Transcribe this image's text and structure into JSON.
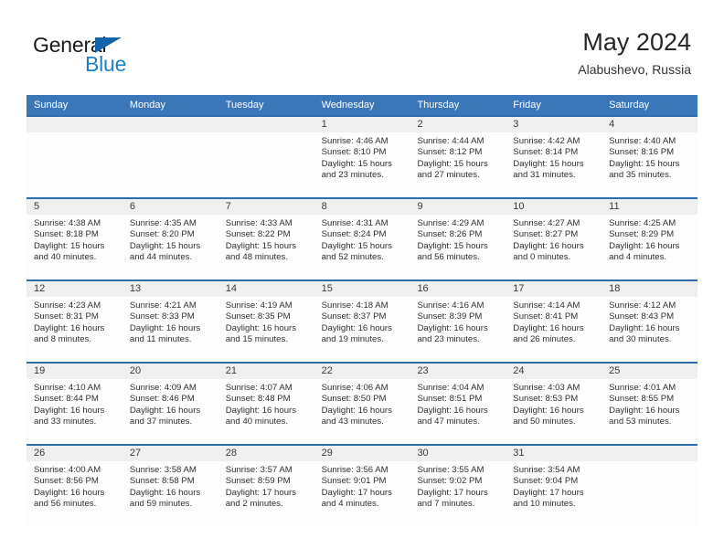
{
  "brand": {
    "line1": "General",
    "line2": "Blue",
    "triangle_icon": "triangle-icon",
    "color_dark": "#1b1b1b",
    "color_blue": "#1f7fc4"
  },
  "header": {
    "title": "May 2024",
    "subtitle": "Alabushevo, Russia"
  },
  "colors": {
    "header_blue": "#3a76b8",
    "row_divider_blue": "#2e6da9",
    "date_band_gray": "#efefef",
    "body_white": "#fdfdfd"
  },
  "weekdays": [
    "Sunday",
    "Monday",
    "Tuesday",
    "Wednesday",
    "Thursday",
    "Friday",
    "Saturday"
  ],
  "weeks": [
    [
      {
        "day": "",
        "l1": "",
        "l2": "",
        "l3": "",
        "l4": ""
      },
      {
        "day": "",
        "l1": "",
        "l2": "",
        "l3": "",
        "l4": ""
      },
      {
        "day": "",
        "l1": "",
        "l2": "",
        "l3": "",
        "l4": ""
      },
      {
        "day": "1",
        "l1": "Sunrise: 4:46 AM",
        "l2": "Sunset: 8:10 PM",
        "l3": "Daylight: 15 hours",
        "l4": "and 23 minutes."
      },
      {
        "day": "2",
        "l1": "Sunrise: 4:44 AM",
        "l2": "Sunset: 8:12 PM",
        "l3": "Daylight: 15 hours",
        "l4": "and 27 minutes."
      },
      {
        "day": "3",
        "l1": "Sunrise: 4:42 AM",
        "l2": "Sunset: 8:14 PM",
        "l3": "Daylight: 15 hours",
        "l4": "and 31 minutes."
      },
      {
        "day": "4",
        "l1": "Sunrise: 4:40 AM",
        "l2": "Sunset: 8:16 PM",
        "l3": "Daylight: 15 hours",
        "l4": "and 35 minutes."
      }
    ],
    [
      {
        "day": "5",
        "l1": "Sunrise: 4:38 AM",
        "l2": "Sunset: 8:18 PM",
        "l3": "Daylight: 15 hours",
        "l4": "and 40 minutes."
      },
      {
        "day": "6",
        "l1": "Sunrise: 4:35 AM",
        "l2": "Sunset: 8:20 PM",
        "l3": "Daylight: 15 hours",
        "l4": "and 44 minutes."
      },
      {
        "day": "7",
        "l1": "Sunrise: 4:33 AM",
        "l2": "Sunset: 8:22 PM",
        "l3": "Daylight: 15 hours",
        "l4": "and 48 minutes."
      },
      {
        "day": "8",
        "l1": "Sunrise: 4:31 AM",
        "l2": "Sunset: 8:24 PM",
        "l3": "Daylight: 15 hours",
        "l4": "and 52 minutes."
      },
      {
        "day": "9",
        "l1": "Sunrise: 4:29 AM",
        "l2": "Sunset: 8:26 PM",
        "l3": "Daylight: 15 hours",
        "l4": "and 56 minutes."
      },
      {
        "day": "10",
        "l1": "Sunrise: 4:27 AM",
        "l2": "Sunset: 8:27 PM",
        "l3": "Daylight: 16 hours",
        "l4": "and 0 minutes."
      },
      {
        "day": "11",
        "l1": "Sunrise: 4:25 AM",
        "l2": "Sunset: 8:29 PM",
        "l3": "Daylight: 16 hours",
        "l4": "and 4 minutes."
      }
    ],
    [
      {
        "day": "12",
        "l1": "Sunrise: 4:23 AM",
        "l2": "Sunset: 8:31 PM",
        "l3": "Daylight: 16 hours",
        "l4": "and 8 minutes."
      },
      {
        "day": "13",
        "l1": "Sunrise: 4:21 AM",
        "l2": "Sunset: 8:33 PM",
        "l3": "Daylight: 16 hours",
        "l4": "and 11 minutes."
      },
      {
        "day": "14",
        "l1": "Sunrise: 4:19 AM",
        "l2": "Sunset: 8:35 PM",
        "l3": "Daylight: 16 hours",
        "l4": "and 15 minutes."
      },
      {
        "day": "15",
        "l1": "Sunrise: 4:18 AM",
        "l2": "Sunset: 8:37 PM",
        "l3": "Daylight: 16 hours",
        "l4": "and 19 minutes."
      },
      {
        "day": "16",
        "l1": "Sunrise: 4:16 AM",
        "l2": "Sunset: 8:39 PM",
        "l3": "Daylight: 16 hours",
        "l4": "and 23 minutes."
      },
      {
        "day": "17",
        "l1": "Sunrise: 4:14 AM",
        "l2": "Sunset: 8:41 PM",
        "l3": "Daylight: 16 hours",
        "l4": "and 26 minutes."
      },
      {
        "day": "18",
        "l1": "Sunrise: 4:12 AM",
        "l2": "Sunset: 8:43 PM",
        "l3": "Daylight: 16 hours",
        "l4": "and 30 minutes."
      }
    ],
    [
      {
        "day": "19",
        "l1": "Sunrise: 4:10 AM",
        "l2": "Sunset: 8:44 PM",
        "l3": "Daylight: 16 hours",
        "l4": "and 33 minutes."
      },
      {
        "day": "20",
        "l1": "Sunrise: 4:09 AM",
        "l2": "Sunset: 8:46 PM",
        "l3": "Daylight: 16 hours",
        "l4": "and 37 minutes."
      },
      {
        "day": "21",
        "l1": "Sunrise: 4:07 AM",
        "l2": "Sunset: 8:48 PM",
        "l3": "Daylight: 16 hours",
        "l4": "and 40 minutes."
      },
      {
        "day": "22",
        "l1": "Sunrise: 4:06 AM",
        "l2": "Sunset: 8:50 PM",
        "l3": "Daylight: 16 hours",
        "l4": "and 43 minutes."
      },
      {
        "day": "23",
        "l1": "Sunrise: 4:04 AM",
        "l2": "Sunset: 8:51 PM",
        "l3": "Daylight: 16 hours",
        "l4": "and 47 minutes."
      },
      {
        "day": "24",
        "l1": "Sunrise: 4:03 AM",
        "l2": "Sunset: 8:53 PM",
        "l3": "Daylight: 16 hours",
        "l4": "and 50 minutes."
      },
      {
        "day": "25",
        "l1": "Sunrise: 4:01 AM",
        "l2": "Sunset: 8:55 PM",
        "l3": "Daylight: 16 hours",
        "l4": "and 53 minutes."
      }
    ],
    [
      {
        "day": "26",
        "l1": "Sunrise: 4:00 AM",
        "l2": "Sunset: 8:56 PM",
        "l3": "Daylight: 16 hours",
        "l4": "and 56 minutes."
      },
      {
        "day": "27",
        "l1": "Sunrise: 3:58 AM",
        "l2": "Sunset: 8:58 PM",
        "l3": "Daylight: 16 hours",
        "l4": "and 59 minutes."
      },
      {
        "day": "28",
        "l1": "Sunrise: 3:57 AM",
        "l2": "Sunset: 8:59 PM",
        "l3": "Daylight: 17 hours",
        "l4": "and 2 minutes."
      },
      {
        "day": "29",
        "l1": "Sunrise: 3:56 AM",
        "l2": "Sunset: 9:01 PM",
        "l3": "Daylight: 17 hours",
        "l4": "and 4 minutes."
      },
      {
        "day": "30",
        "l1": "Sunrise: 3:55 AM",
        "l2": "Sunset: 9:02 PM",
        "l3": "Daylight: 17 hours",
        "l4": "and 7 minutes."
      },
      {
        "day": "31",
        "l1": "Sunrise: 3:54 AM",
        "l2": "Sunset: 9:04 PM",
        "l3": "Daylight: 17 hours",
        "l4": "and 10 minutes."
      },
      {
        "day": "",
        "l1": "",
        "l2": "",
        "l3": "",
        "l4": ""
      }
    ]
  ]
}
